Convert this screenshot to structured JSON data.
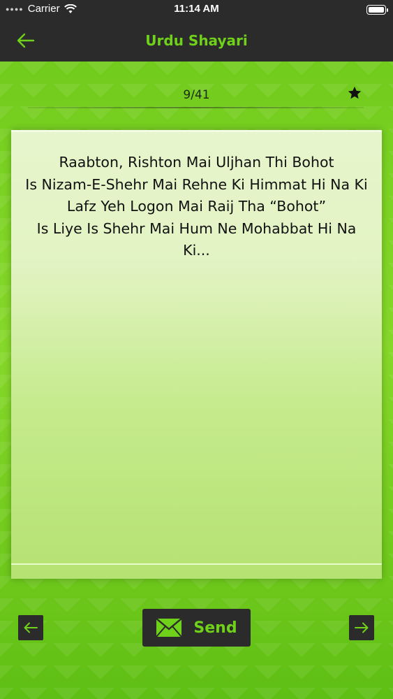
{
  "status_bar": {
    "carrier": "Carrier",
    "time": "11:14 AM"
  },
  "nav": {
    "title": "Urdu Shayari",
    "back_icon": "arrow-left-icon"
  },
  "counter": {
    "text": "9/41",
    "favorite_icon": "star-icon"
  },
  "shayari": {
    "text": "Raabton, Rishton Mai Uljhan Thi Bohot\nIs Nizam-E-Shehr Mai Rehne Ki Himmat Hi Na Ki\nLafz Yeh Logon Mai Raij Tha “Bohot”\nIs Liye Is Shehr Mai Hum Ne Mohabbat Hi Na Ki..."
  },
  "controls": {
    "prev_icon": "arrow-left-icon",
    "next_icon": "arrow-right-icon",
    "send_label": "Send",
    "send_icon": "envelope-icon"
  },
  "colors": {
    "accent": "#6fd11a",
    "bar_background": "#2b2b2b",
    "background_green": "#7bd222"
  }
}
